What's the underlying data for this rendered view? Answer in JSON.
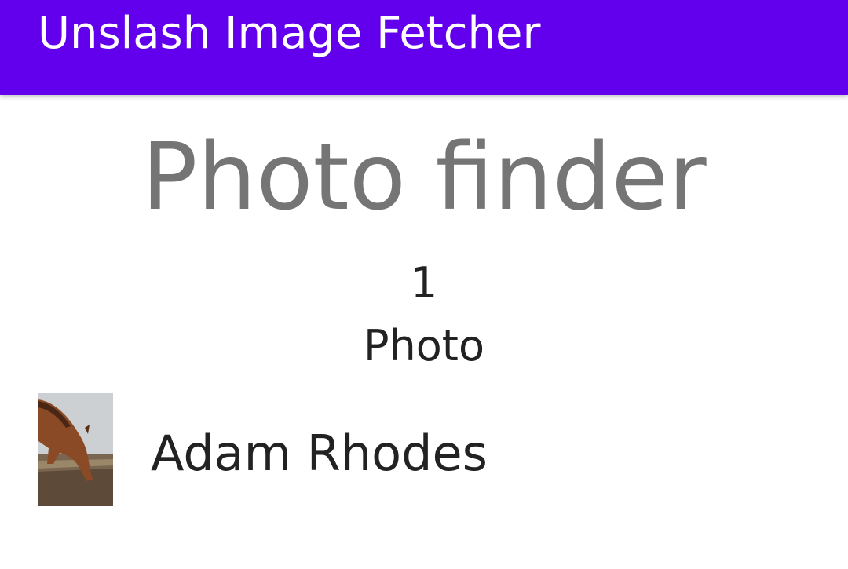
{
  "app_bar": {
    "title": "Unslash Image Fetcher",
    "color": "#6200ee"
  },
  "main": {
    "heading": "Photo finder",
    "photo_count": "1",
    "photo_count_label": "Photo"
  },
  "results": [
    {
      "author": "Adam Rhodes",
      "thumbnail_icon": "horse-grazing-photo"
    }
  ]
}
